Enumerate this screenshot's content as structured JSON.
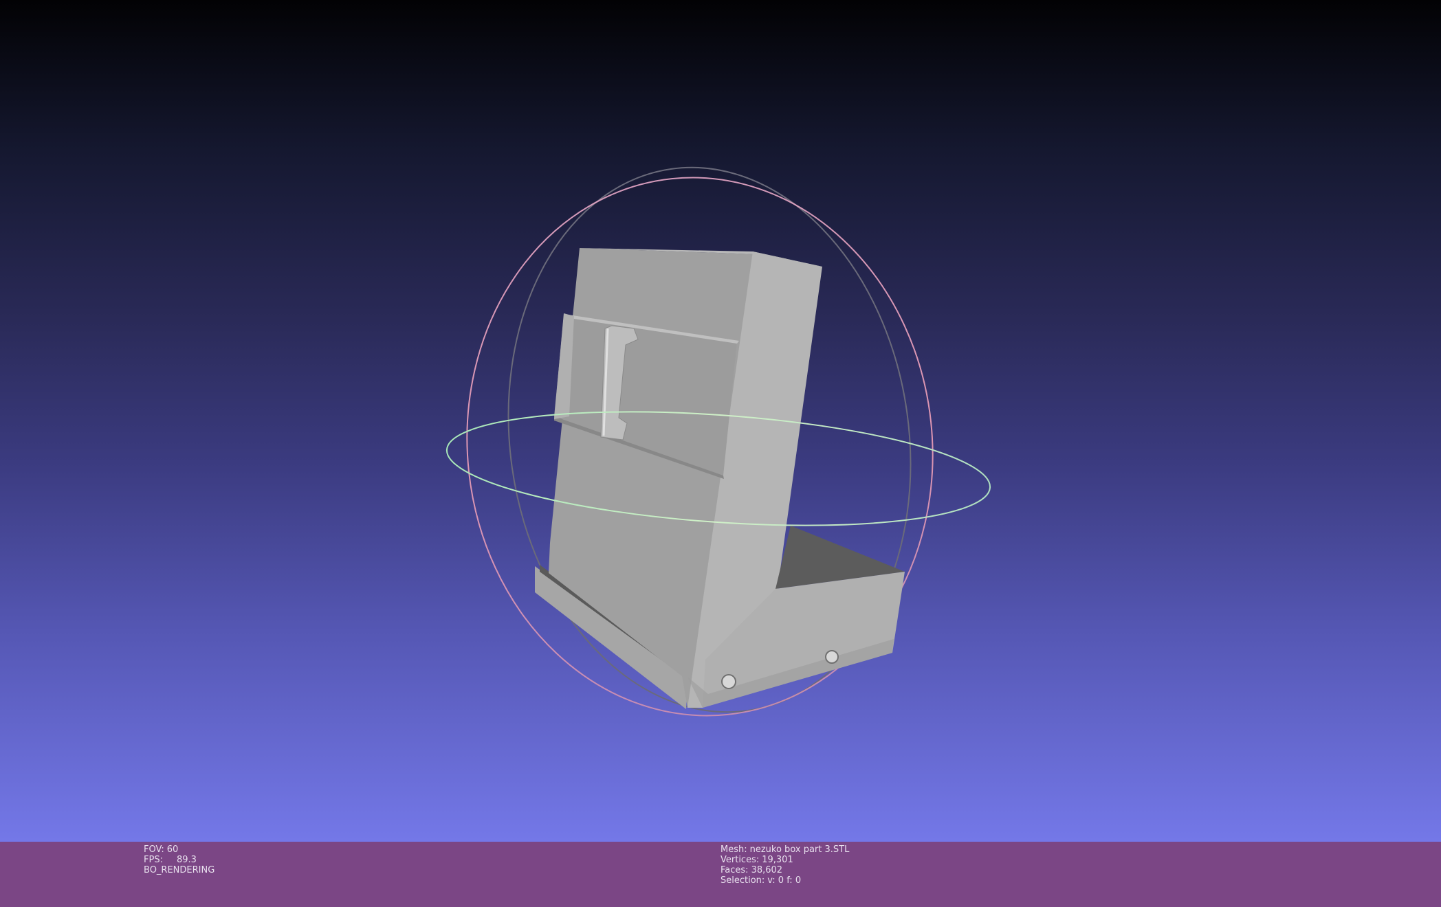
{
  "info": {
    "fov_label": "FOV:",
    "fov_value": "60",
    "fps_label": "FPS:",
    "fps_value": "89.3",
    "render_mode": "BO_RENDERING",
    "mesh_label": "Mesh:",
    "mesh_name": "nezuko box part 3.STL",
    "vertices_label": "Vertices:",
    "vertices_value": "19,301",
    "faces_label": "Faces:",
    "faces_value": "38,602",
    "selection_label": "Selection:",
    "selection_value": "v: 0 f: 0"
  },
  "colors": {
    "info_bar": "#7b4685",
    "background_top": "#020204",
    "background_bottom": "#7478e8",
    "mesh": "#a8a8a8"
  }
}
